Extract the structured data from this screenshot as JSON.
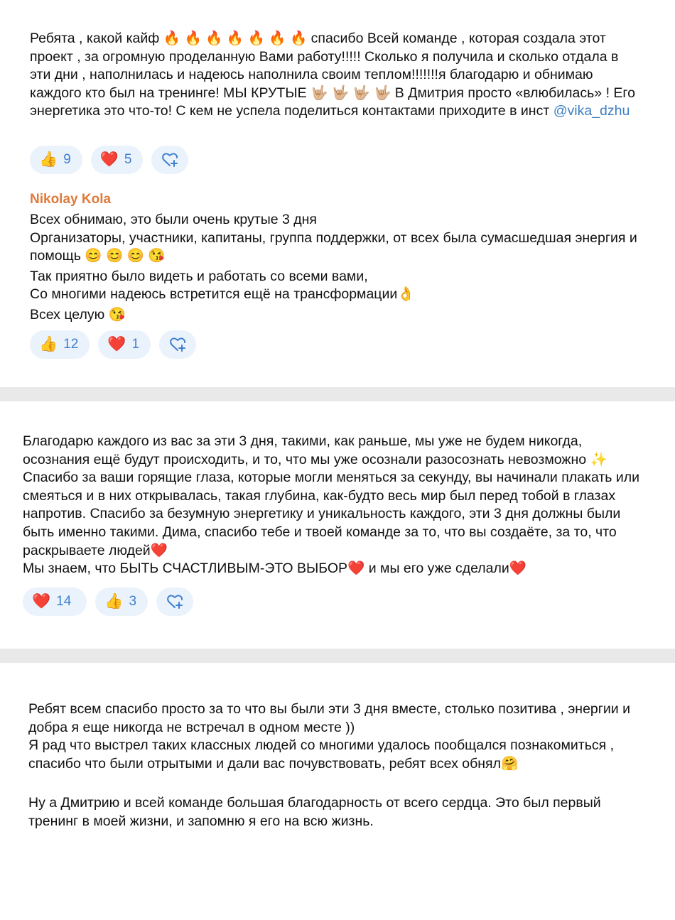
{
  "posts": [
    {
      "lines": [
        "Ребята , какой кайф 🔥 🔥 🔥 🔥 🔥 🔥 🔥  спасибо Всей команде , которая создала этот проект , за огромную проделанную Вами работу!!!!! Сколько я получила и сколько отдала в эти дни , наполнилась и надеюсь наполнила своим теплом!!!!!!!я благодарю и обнимаю каждого кто был на тренинге! МЫ КРУТЫЕ 🤟🏼 🤟🏼 🤟🏼 🤟🏼  В Дмитрия просто «влюбилась» ! Его энергетика это что-то! С кем не успела поделиться контактами приходите в инст "
      ],
      "mention": "@vika_dzhu",
      "reactions": [
        {
          "emoji": "👍",
          "count": "9"
        },
        {
          "emoji": "❤️",
          "count": "5"
        }
      ]
    },
    {
      "author": "Nikolay Kola",
      "lines": [
        "Всех обнимаю, это были очень крутые 3 дня",
        "Организаторы, участники, капитаны, группа поддержки, от всех была сумасшедшая энергия и помощь 😊 😊 😊 😘",
        "Так приятно было видеть и работать со всеми вами,",
        "Со многими надеюсь встретится ещё на трансформации👌",
        "Всех целую 😘"
      ],
      "reactions": [
        {
          "emoji": "👍",
          "count": "12"
        },
        {
          "emoji": "❤️",
          "count": "1"
        }
      ]
    },
    {
      "lines": [
        "Благодарю каждого из вас за эти 3 дня, такими, как раньше, мы уже не будем никогда, осознания ещё будут происходить, и то, что мы уже осознали разосознать невозможно ✨ Спасибо за ваши горящие глаза, которые могли меняться за секунду, вы начинали плакать или смеяться и в них открывалась, такая глубина, как-будто весь мир был перед тобой в глазах напротив. Спасибо за безумную энергетику и уникальность каждого, эти 3 дня должны были быть именно такими. Дима, спасибо тебе и твоей команде за то, что вы создаёте, за то, что раскрываете людей❤️",
        "Мы знаем, что БЫТЬ СЧАСТЛИВЫМ-ЭТО ВЫБОР❤️ и мы его уже сделали❤️"
      ],
      "reactions": [
        {
          "emoji": "❤️",
          "count": "14"
        },
        {
          "emoji": "👍",
          "count": "3"
        }
      ]
    },
    {
      "lines": [
        "Ребят всем спасибо просто за то что вы были эти 3 дня вместе, столько позитива , энергии и добра я еще никогда не встречал в одном месте ))",
        "Я рад что выстрел таких классных людей со многими удалось пообщался познакомиться , спасибо что были отрытыми и дали вас почувствовать, ребят всех обнял🤗",
        " ",
        "Ну а Дмитрию и всей команде большая благодарность от всего сердца. Это был первый тренинг в моей жизни, и запомню я его на всю жизнь."
      ]
    }
  ],
  "colors": {
    "accent": "#3f7fcf",
    "author": "#e07a3a",
    "pill_bg": "#eaf2fc",
    "separator": "#e9e9e9"
  },
  "icons": {
    "add_reaction": "heart-plus-icon"
  }
}
